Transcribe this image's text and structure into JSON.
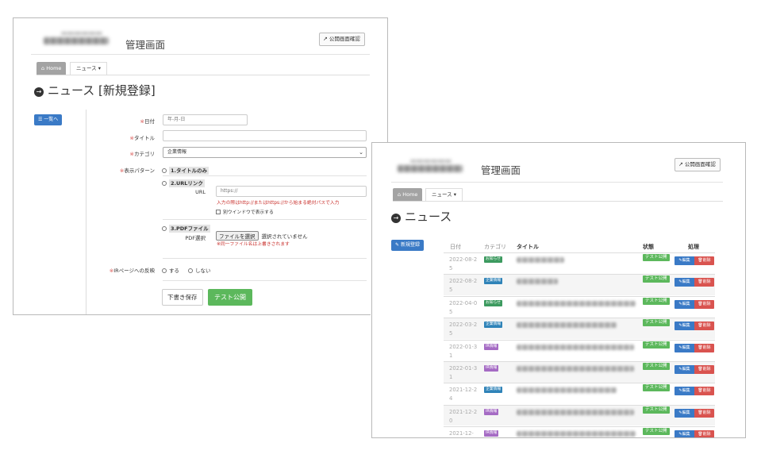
{
  "colors": {
    "accent_blue": "#3a7ac6",
    "green": "#5cb85c",
    "red": "#d9534f",
    "oshirase": "#3c9a5f",
    "kigyo": "#2f83b8",
    "ir": "#a56bc4"
  },
  "form_window": {
    "admin_title": "管理画面",
    "public_button": "公開画面確認",
    "breadcrumb": {
      "home": "Home",
      "current": "ニュース"
    },
    "page_title": "ニュース [新規登録]",
    "back_button": "一覧へ",
    "fields": {
      "date": {
        "label": "日付",
        "placeholder": "年-月-日"
      },
      "title": {
        "label": "タイトル",
        "value": ""
      },
      "category": {
        "label": "カテゴリ",
        "value": "企業情報"
      },
      "pattern": {
        "label": "表示パターン",
        "opt1": "1.タイトルのみ",
        "opt2": "2.URLリンク",
        "url_label": "URL",
        "url_placeholder": "https://",
        "url_note": "入力の際はhttp://またはhttps://から始まる絶対パスで入力",
        "new_window": "別ウインドウで表示する",
        "opt3": "3.PDFファイル",
        "pdf_label": "PDF選択",
        "file_button": "ファイルを選択",
        "file_status": "選択されていません",
        "pdf_note": "※同一ファイル名は上書きされます"
      },
      "ir": {
        "label": "IRページへの反映",
        "yes": "する",
        "no": "しない"
      }
    },
    "draft_button": "下書き保存",
    "test_publish_button": "テスト公開"
  },
  "list_window": {
    "admin_title": "管理画面",
    "public_button": "公開画面確認",
    "breadcrumb": {
      "home": "Home",
      "current": "ニュース"
    },
    "page_title": "ニュース",
    "new_button": "新規登録",
    "headers": {
      "date": "日付",
      "category": "カテゴリ",
      "title": "タイトル",
      "status": "状態",
      "actions": "処理"
    },
    "rows": [
      {
        "date": "2022-08-25",
        "cat": "お知らせ",
        "cat_color": "#3c9a5f",
        "title_w": 60,
        "status": "テスト公開",
        "edit": "編集",
        "del": "削除"
      },
      {
        "date": "2022-08-25",
        "cat": "企業情報",
        "cat_color": "#2f83b8",
        "title_w": 52,
        "status": "テスト公開",
        "edit": "編集",
        "del": "削除"
      },
      {
        "date": "2022-04-05",
        "cat": "お知らせ",
        "cat_color": "#3c9a5f",
        "title_w": 150,
        "status": "テスト公開",
        "edit": "編集",
        "del": "削除"
      },
      {
        "date": "2022-03-25",
        "cat": "企業情報",
        "cat_color": "#2f83b8",
        "title_w": 126,
        "status": "テスト公開",
        "edit": "編集",
        "del": "削除"
      },
      {
        "date": "2022-01-31",
        "cat": "IR情報",
        "cat_color": "#a56bc4",
        "title_w": 148,
        "status": "テスト公開",
        "edit": "編集",
        "del": "削除"
      },
      {
        "date": "2022-01-31",
        "cat": "IR情報",
        "cat_color": "#a56bc4",
        "title_w": 148,
        "status": "テスト公開",
        "edit": "編集",
        "del": "削除"
      },
      {
        "date": "2021-12-24",
        "cat": "企業情報",
        "cat_color": "#2f83b8",
        "title_w": 126,
        "status": "テスト公開",
        "edit": "編集",
        "del": "削除"
      },
      {
        "date": "2021-12-20",
        "cat": "IR情報",
        "cat_color": "#a56bc4",
        "title_w": 148,
        "status": "テスト公開",
        "edit": "編集",
        "del": "削除"
      },
      {
        "date": "2021-12-",
        "cat": "IR情報",
        "cat_color": "#a56bc4",
        "title_w": 150,
        "status": "テスト公開",
        "edit": "編集",
        "del": "削除"
      }
    ]
  }
}
